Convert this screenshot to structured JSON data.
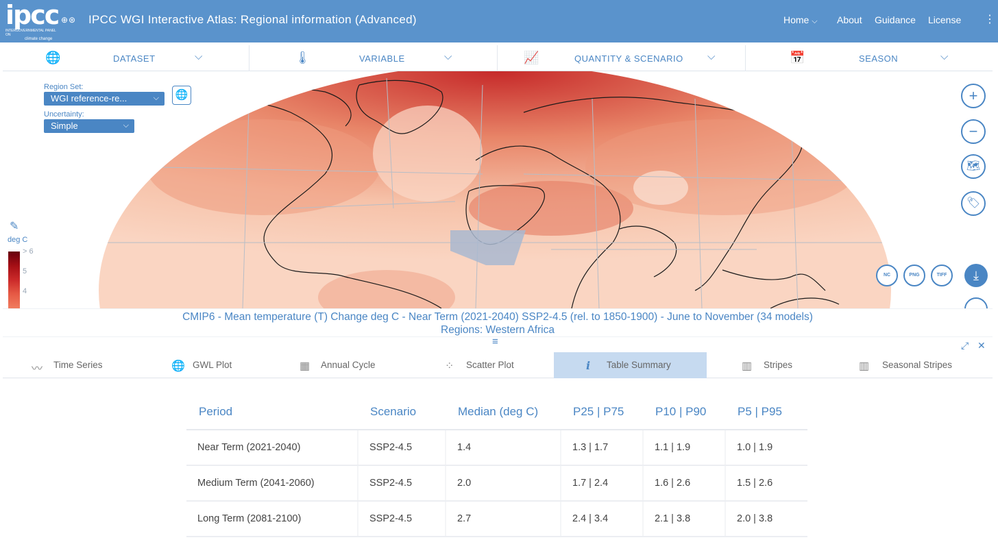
{
  "header": {
    "logo_text": "ipcc",
    "logo_subtext": "INTERGOVERNMENTAL PANEL ON",
    "logo_subtext2": "climate change",
    "partner_icons": "WMO UNEP",
    "title": "IPCC WGI Interactive Atlas: Regional information (Advanced)",
    "nav": {
      "home": "Home",
      "about": "About",
      "guidance": "Guidance",
      "license": "License"
    }
  },
  "selectors": [
    {
      "icon": "globe-icon",
      "label": "DATASET"
    },
    {
      "icon": "thermometer-icon",
      "label": "VARIABLE"
    },
    {
      "icon": "line-chart-icon",
      "label": "QUANTITY & SCENARIO"
    },
    {
      "icon": "calendar-icon",
      "label": "SEASON"
    }
  ],
  "map_controls": {
    "region_set_label": "Region Set:",
    "region_set_value": "WGI reference-re...",
    "uncertainty_label": "Uncertainty:",
    "uncertainty_value": "Simple",
    "legend_unit": "deg C",
    "legend_ticks": [
      "> 6",
      "5",
      "4"
    ],
    "download_formats": [
      "NC",
      "PNG",
      "TIFF"
    ],
    "highlighted_region": "Western Africa",
    "colors": {
      "accent": "#4a86c4",
      "header": "#5a93cc",
      "map_warm": "#f7c4ac",
      "map_hot": "#c62a2a",
      "region_highlight": "#a9b8d0"
    }
  },
  "caption": {
    "line1": "CMIP6 - Mean temperature (T) Change deg C - Near Term (2021-2040) SSP2-4.5 (rel. to 1850-1900) - June to November (34 models)",
    "line2": "Regions: Western Africa"
  },
  "tabs": [
    {
      "icon": "time-series-icon",
      "label": "Time Series",
      "active": false
    },
    {
      "icon": "globe-icon",
      "label": "GWL Plot",
      "active": false
    },
    {
      "icon": "calendar-icon",
      "label": "Annual Cycle",
      "active": false
    },
    {
      "icon": "scatter-icon",
      "label": "Scatter Plot",
      "active": false
    },
    {
      "icon": "info-icon",
      "label": "Table Summary",
      "active": true
    },
    {
      "icon": "barcode-icon",
      "label": "Stripes",
      "active": false
    },
    {
      "icon": "seasonal-stripes-icon",
      "label": "Seasonal Stripes",
      "active": false
    }
  ],
  "table": {
    "headers": [
      "Period",
      "Scenario",
      "Median (deg C)",
      "P25 | P75",
      "P10 | P90",
      "P5 | P95"
    ],
    "rows": [
      [
        "Near Term (2021-2040)",
        "SSP2-4.5",
        "1.4",
        "1.3 | 1.7",
        "1.1 | 1.9",
        "1.0 | 1.9"
      ],
      [
        "Medium Term (2041-2060)",
        "SSP2-4.5",
        "2.0",
        "1.7 | 2.4",
        "1.6 | 2.6",
        "1.5 | 2.6"
      ],
      [
        "Long Term (2081-2100)",
        "SSP2-4.5",
        "2.7",
        "2.4 | 3.4",
        "2.1 | 3.8",
        "2.0 | 3.8"
      ]
    ]
  }
}
